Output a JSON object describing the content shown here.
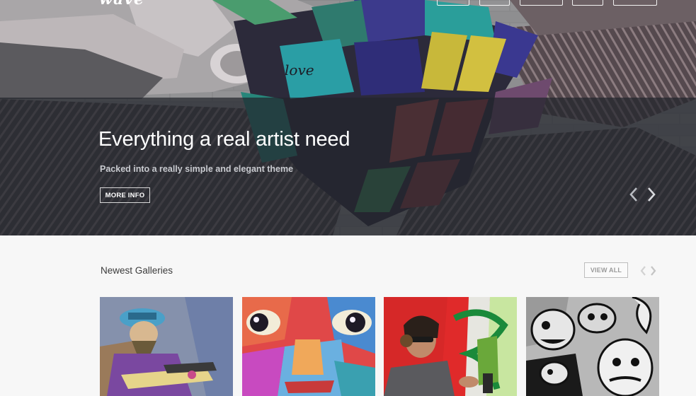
{
  "header": {
    "logo": "wave"
  },
  "hero": {
    "title": "Everything a real artist need",
    "subtitle": "Packed into a really simple and elegant theme",
    "button_label": "MORE INFO",
    "mural_text": "love"
  },
  "galleries": {
    "title": "Newest Galleries",
    "view_all_label": "VIEW ALL",
    "items": [
      {
        "subject": "guitarist-illustration"
      },
      {
        "subject": "colorful-face-painting"
      },
      {
        "subject": "graffiti-artist-spraying"
      },
      {
        "subject": "black-and-white-doodle-characters"
      }
    ]
  },
  "colors": {
    "overlay": "#23252c",
    "page_bg": "#f7f7f7",
    "text_dark": "#3b3b3b",
    "button_border": "#bdbdbd"
  }
}
